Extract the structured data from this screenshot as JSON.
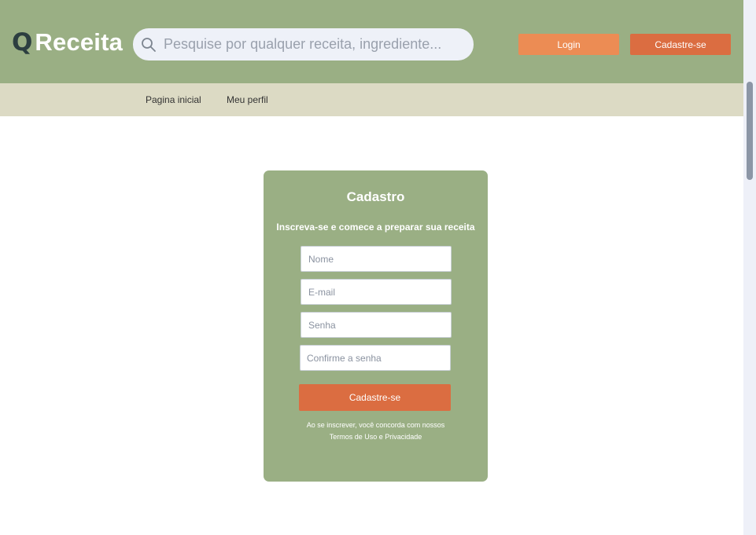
{
  "header": {
    "logo_mark": "Q",
    "logo_text": "Receita",
    "search_placeholder": "Pesquise por qualquer receita, ingrediente...",
    "login_label": "Login",
    "signup_label": "Cadastre-se"
  },
  "nav": {
    "items": [
      {
        "label": "Pagina inicial"
      },
      {
        "label": "Meu perfil"
      }
    ]
  },
  "form": {
    "title": "Cadastro",
    "subtitle": "Inscreva-se e comece a preparar sua receita",
    "fields": [
      {
        "placeholder": "Nome",
        "value": ""
      },
      {
        "placeholder": "E-mail",
        "value": ""
      },
      {
        "placeholder": "Senha",
        "value": ""
      },
      {
        "placeholder": "Confirme a senha",
        "value": ""
      }
    ],
    "submit_label": "Cadastre-se",
    "terms_text": "Ao se inscrever, você concorda com nossos",
    "terms_link": "Termos de Uso e Privacidade"
  },
  "colors": {
    "header_bg": "#9aaf84",
    "nav_bg": "#dcdac4",
    "login_button": "#ec8c54",
    "signup_button": "#db6d41",
    "logo_mark": "#2c3e40"
  },
  "icons": {
    "search": "search-icon"
  }
}
